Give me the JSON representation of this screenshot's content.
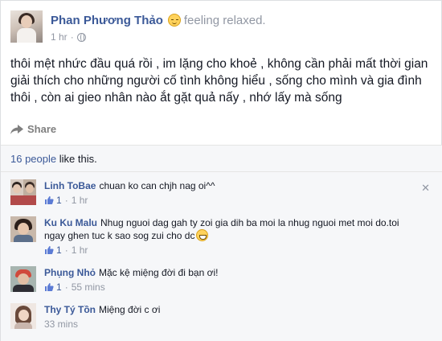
{
  "post": {
    "author": "Phan Phương Thảo",
    "feeling": "feeling relaxed.",
    "time": "1 hr",
    "separator": "·",
    "text": "thôi mệt nhức đầu quá rồi , im lặng cho khoẻ , không cần phải mất thời gian giải thích cho những người cố tình không hiểu , sống cho mình và gia đình thôi , còn ai gieo nhân nào ắt gặt quả nấy , nhớ lấy mà sống",
    "share_label": "Share"
  },
  "likes": {
    "count_text": "16 people",
    "rest_text": " like this."
  },
  "comments": [
    {
      "author": "Linh ToBae",
      "text": "chuan ko can chjh nag oi^^",
      "likes": "1",
      "time": "1 hr"
    },
    {
      "author": "Ku Ku Malu",
      "text": "Nhug nguoi dag gah ty zoi gia dih ba moi la nhug nguoi met moi do.toi ngay ghen tuc k sao sog zui cho dc",
      "likes": "1",
      "time": "1 hr"
    },
    {
      "author": "Phụng Nhỏ",
      "text": "Mặc kệ miệng đời đi bạn ơi!",
      "likes": "1",
      "time": "55 mins"
    },
    {
      "author": "Thy Tý Tồn",
      "text": "Miệng đời c ơi",
      "likes": "",
      "time": "33 mins"
    }
  ],
  "icons": {
    "feeling": "relaxed-emoji-icon",
    "privacy": "globe-icon",
    "share": "share-arrow-icon",
    "like": "thumbs-up-icon",
    "close": "close-icon",
    "emoji_in_comment": "grin-emoji-icon"
  },
  "colors": {
    "link_blue": "#3b5998",
    "meta_gray": "#9197a3",
    "comments_bg": "#f6f7f9"
  }
}
